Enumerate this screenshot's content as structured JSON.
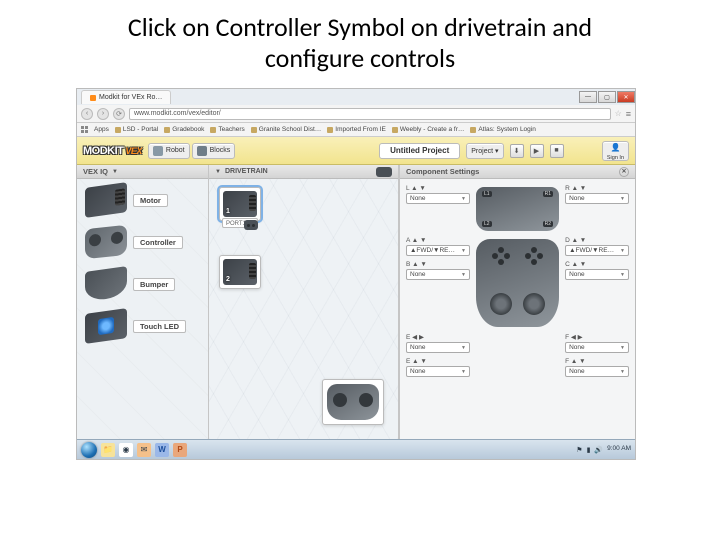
{
  "slide": {
    "title_line1": "Click on Controller Symbol on drivetrain and",
    "title_line2": "configure  controls"
  },
  "browser": {
    "tab_title": "Modkit for VEx Ro…",
    "url": "www.modkit.com/vex/editor/",
    "window_buttons": {
      "min": "—",
      "max": "▢",
      "close": "✕"
    },
    "bookmarks_label": "Apps",
    "bookmarks": [
      {
        "label": "LSD - Portal"
      },
      {
        "label": "Gradebook"
      },
      {
        "label": "Teachers"
      },
      {
        "label": "Granite School Dist…"
      },
      {
        "label": "Imported From IE"
      },
      {
        "label": "Weebly - Create a fr…"
      },
      {
        "label": "Atlas: System Login"
      }
    ]
  },
  "app": {
    "logo": "MODKIT",
    "logo_sub": "VEX",
    "robot_chip": "Robot",
    "blocks_chip": "Blocks",
    "project_title": "Untitled Project",
    "project_menu": "Project ▾",
    "sign_in": "Sign In"
  },
  "sidebar": {
    "header": "VEX IQ",
    "items": [
      {
        "label": "Motor",
        "part": "motor"
      },
      {
        "label": "Controller",
        "part": "controller"
      },
      {
        "label": "Bumper",
        "part": "bumper"
      },
      {
        "label": "Touch LED",
        "part": "touch"
      }
    ]
  },
  "stage": {
    "header": "DRIVETRAIN",
    "motor1": {
      "num": "1",
      "port": "PORT1 ▾"
    },
    "motor2": {
      "num": "2"
    }
  },
  "settings": {
    "title": "Component Settings",
    "fields": {
      "L_top": {
        "label": "L ▲ ▼",
        "value": "None"
      },
      "R_top": {
        "label": "R ▲ ▼",
        "value": "None"
      },
      "A": {
        "label": "A ▲ ▼",
        "value": "▲FWD/▼RE…"
      },
      "D": {
        "label": "D ▲ ▼",
        "value": "▲FWD/▼RE…"
      },
      "B": {
        "label": "B ▲ ▼",
        "value": "None"
      },
      "C": {
        "label": "C ▲ ▼",
        "value": "None"
      },
      "E_lr": {
        "label": "E ◀ ▶",
        "value": "None"
      },
      "F_lr": {
        "label": "F ◀ ▶",
        "value": "None"
      },
      "E_ud": {
        "label": "E ▲ ▼",
        "value": "None"
      },
      "F_ud": {
        "label": "F ▲ ▼",
        "value": "None"
      }
    },
    "illus_top": {
      "L1": "L1",
      "L2": "L2",
      "R1": "R1",
      "R2": "R2"
    }
  },
  "taskbar": {
    "time": "9:00 AM"
  }
}
